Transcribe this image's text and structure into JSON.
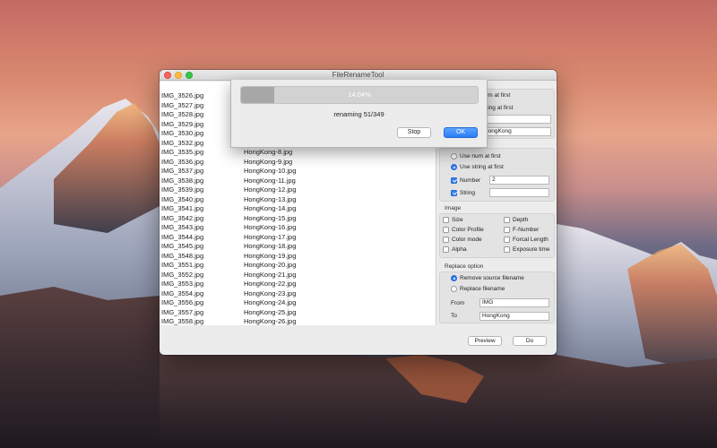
{
  "window": {
    "title": "FileRenameTool"
  },
  "files": [
    [
      "IMG_3526.jpg",
      ""
    ],
    [
      "IMG_3527.jpg",
      ""
    ],
    [
      "IMG_3528.jpg",
      ""
    ],
    [
      "IMG_3529.jpg",
      ""
    ],
    [
      "IMG_3530.jpg",
      ""
    ],
    [
      "IMG_3532.jpg",
      ""
    ],
    [
      "IMG_3535.jpg",
      "HongKong-8.jpg"
    ],
    [
      "IMG_3536.jpg",
      "HongKong-9.jpg"
    ],
    [
      "IMG_3537.jpg",
      "HongKong-10.jpg"
    ],
    [
      "IMG_3538.jpg",
      "HongKong-11.jpg"
    ],
    [
      "IMG_3539.jpg",
      "HongKong-12.jpg"
    ],
    [
      "IMG_3540.jpg",
      "HongKong-13.jpg"
    ],
    [
      "IMG_3541.jpg",
      "HongKong-14.jpg"
    ],
    [
      "IMG_3542.jpg",
      "HongKong-15.jpg"
    ],
    [
      "IMG_3543.jpg",
      "HongKong-16.jpg"
    ],
    [
      "IMG_3544.jpg",
      "HongKong-17.jpg"
    ],
    [
      "IMG_3545.jpg",
      "HongKong-18.jpg"
    ],
    [
      "IMG_3548.jpg",
      "HongKong-19.jpg"
    ],
    [
      "IMG_3551.jpg",
      "HongKong-20.jpg"
    ],
    [
      "IMG_3552.jpg",
      "HongKong-21.jpg"
    ],
    [
      "IMG_3553.jpg",
      "HongKong-22.jpg"
    ],
    [
      "IMG_3554.jpg",
      "HongKong-23.jpg"
    ],
    [
      "IMG_3556.jpg",
      "HongKong-24.jpg"
    ],
    [
      "IMG_3557.jpg",
      "HongKong-25.jpg"
    ],
    [
      "IMG_3558.jpg",
      "HongKong-26.jpg"
    ]
  ],
  "panel": {
    "top_group": {
      "opt1_partial": "num at first",
      "opt2_partial": "string at first",
      "field2_partial": "HongKong"
    },
    "order": {
      "use_num_label": "Use num at first",
      "use_string_label": "Use string at first",
      "number_label": "Number",
      "number_value": "2",
      "string_label": "String",
      "string_value": ""
    },
    "image": {
      "title": "Image",
      "size": "Size",
      "depth": "Depth",
      "color_profile": "Color Profile",
      "f_number": "F-Number",
      "color_mode": "Color mode",
      "forcal_length": "Forcal Length",
      "alpha": "Alpha",
      "exposure_time": "Exposure time"
    },
    "replace": {
      "title": "Replace option",
      "remove_label": "Remove source filename",
      "replace_label": "Replace filename",
      "from_label": "From",
      "from_value": "IMG",
      "to_label": "To",
      "to_value": "HongKong"
    }
  },
  "buttons": {
    "preview": "Preview",
    "do": "Do"
  },
  "dialog": {
    "percent_text": "14.04%",
    "progress_percent": 14.04,
    "status": "renaming 51/349",
    "stop": "Stop",
    "ok": "OK"
  }
}
